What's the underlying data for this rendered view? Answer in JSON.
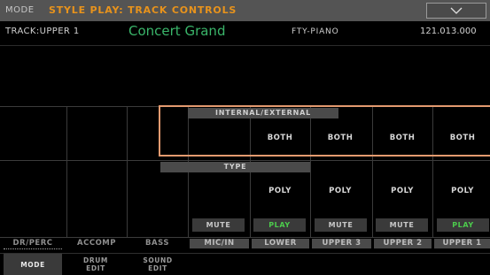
{
  "header": {
    "mode_label": "MODE",
    "title": "STYLE PLAY: TRACK CONTROLS"
  },
  "track": {
    "label": "TRACK:UPPER 1",
    "sound_name": "Concert Grand",
    "bank": "FTY-PIANO",
    "number": "121.013.000"
  },
  "sections": {
    "internal_external": "INTERNAL/EXTERNAL",
    "type": "TYPE"
  },
  "internal_external_values": [
    "BOTH",
    "BOTH",
    "BOTH",
    "BOTH"
  ],
  "type_values": [
    "POLY",
    "POLY",
    "POLY",
    "POLY"
  ],
  "buttons": [
    "MUTE",
    "PLAY",
    "MUTE",
    "MUTE",
    "PLAY"
  ],
  "track_labels": [
    "DR/PERC",
    "ACCOMP",
    "BASS",
    "MIC/IN",
    "LOWER",
    "UPPER 3",
    "UPPER 2",
    "UPPER 1"
  ],
  "tabs": [
    {
      "l1": "MODE",
      "l2": ""
    },
    {
      "l1": "DRUM",
      "l2": "EDIT"
    },
    {
      "l1": "SOUND",
      "l2": "EDIT"
    }
  ],
  "colors": {
    "accent": "#e8931c",
    "sound_name": "#3ab56a",
    "play": "#4ccb4c",
    "highlight": "#e39a6f"
  }
}
